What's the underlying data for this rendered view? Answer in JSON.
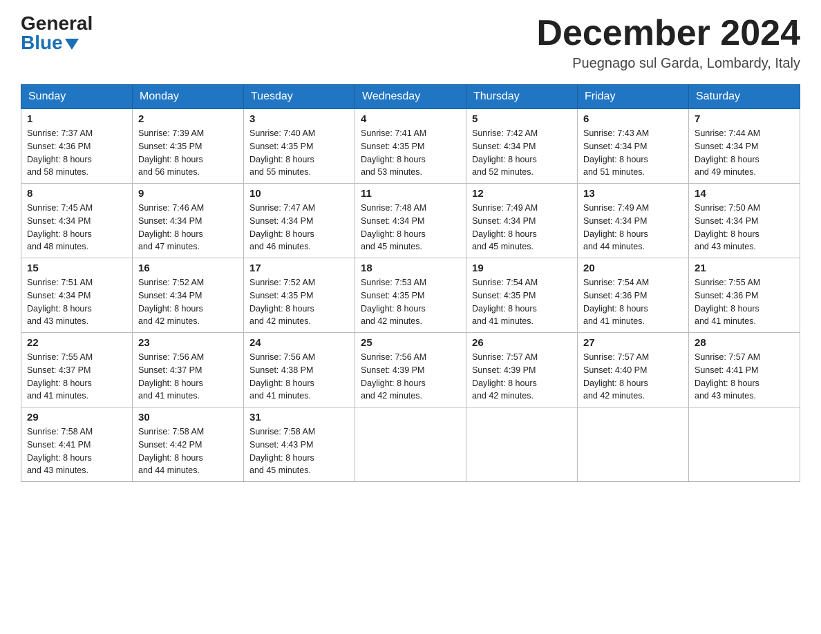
{
  "header": {
    "logo_general": "General",
    "logo_blue": "Blue",
    "month_title": "December 2024",
    "location": "Puegnago sul Garda, Lombardy, Italy"
  },
  "days_of_week": [
    "Sunday",
    "Monday",
    "Tuesday",
    "Wednesday",
    "Thursday",
    "Friday",
    "Saturday"
  ],
  "weeks": [
    [
      {
        "day": "1",
        "sunrise": "7:37 AM",
        "sunset": "4:36 PM",
        "daylight": "8 hours and 58 minutes."
      },
      {
        "day": "2",
        "sunrise": "7:39 AM",
        "sunset": "4:35 PM",
        "daylight": "8 hours and 56 minutes."
      },
      {
        "day": "3",
        "sunrise": "7:40 AM",
        "sunset": "4:35 PM",
        "daylight": "8 hours and 55 minutes."
      },
      {
        "day": "4",
        "sunrise": "7:41 AM",
        "sunset": "4:35 PM",
        "daylight": "8 hours and 53 minutes."
      },
      {
        "day": "5",
        "sunrise": "7:42 AM",
        "sunset": "4:34 PM",
        "daylight": "8 hours and 52 minutes."
      },
      {
        "day": "6",
        "sunrise": "7:43 AM",
        "sunset": "4:34 PM",
        "daylight": "8 hours and 51 minutes."
      },
      {
        "day": "7",
        "sunrise": "7:44 AM",
        "sunset": "4:34 PM",
        "daylight": "8 hours and 49 minutes."
      }
    ],
    [
      {
        "day": "8",
        "sunrise": "7:45 AM",
        "sunset": "4:34 PM",
        "daylight": "8 hours and 48 minutes."
      },
      {
        "day": "9",
        "sunrise": "7:46 AM",
        "sunset": "4:34 PM",
        "daylight": "8 hours and 47 minutes."
      },
      {
        "day": "10",
        "sunrise": "7:47 AM",
        "sunset": "4:34 PM",
        "daylight": "8 hours and 46 minutes."
      },
      {
        "day": "11",
        "sunrise": "7:48 AM",
        "sunset": "4:34 PM",
        "daylight": "8 hours and 45 minutes."
      },
      {
        "day": "12",
        "sunrise": "7:49 AM",
        "sunset": "4:34 PM",
        "daylight": "8 hours and 45 minutes."
      },
      {
        "day": "13",
        "sunrise": "7:49 AM",
        "sunset": "4:34 PM",
        "daylight": "8 hours and 44 minutes."
      },
      {
        "day": "14",
        "sunrise": "7:50 AM",
        "sunset": "4:34 PM",
        "daylight": "8 hours and 43 minutes."
      }
    ],
    [
      {
        "day": "15",
        "sunrise": "7:51 AM",
        "sunset": "4:34 PM",
        "daylight": "8 hours and 43 minutes."
      },
      {
        "day": "16",
        "sunrise": "7:52 AM",
        "sunset": "4:34 PM",
        "daylight": "8 hours and 42 minutes."
      },
      {
        "day": "17",
        "sunrise": "7:52 AM",
        "sunset": "4:35 PM",
        "daylight": "8 hours and 42 minutes."
      },
      {
        "day": "18",
        "sunrise": "7:53 AM",
        "sunset": "4:35 PM",
        "daylight": "8 hours and 42 minutes."
      },
      {
        "day": "19",
        "sunrise": "7:54 AM",
        "sunset": "4:35 PM",
        "daylight": "8 hours and 41 minutes."
      },
      {
        "day": "20",
        "sunrise": "7:54 AM",
        "sunset": "4:36 PM",
        "daylight": "8 hours and 41 minutes."
      },
      {
        "day": "21",
        "sunrise": "7:55 AM",
        "sunset": "4:36 PM",
        "daylight": "8 hours and 41 minutes."
      }
    ],
    [
      {
        "day": "22",
        "sunrise": "7:55 AM",
        "sunset": "4:37 PM",
        "daylight": "8 hours and 41 minutes."
      },
      {
        "day": "23",
        "sunrise": "7:56 AM",
        "sunset": "4:37 PM",
        "daylight": "8 hours and 41 minutes."
      },
      {
        "day": "24",
        "sunrise": "7:56 AM",
        "sunset": "4:38 PM",
        "daylight": "8 hours and 41 minutes."
      },
      {
        "day": "25",
        "sunrise": "7:56 AM",
        "sunset": "4:39 PM",
        "daylight": "8 hours and 42 minutes."
      },
      {
        "day": "26",
        "sunrise": "7:57 AM",
        "sunset": "4:39 PM",
        "daylight": "8 hours and 42 minutes."
      },
      {
        "day": "27",
        "sunrise": "7:57 AM",
        "sunset": "4:40 PM",
        "daylight": "8 hours and 42 minutes."
      },
      {
        "day": "28",
        "sunrise": "7:57 AM",
        "sunset": "4:41 PM",
        "daylight": "8 hours and 43 minutes."
      }
    ],
    [
      {
        "day": "29",
        "sunrise": "7:58 AM",
        "sunset": "4:41 PM",
        "daylight": "8 hours and 43 minutes."
      },
      {
        "day": "30",
        "sunrise": "7:58 AM",
        "sunset": "4:42 PM",
        "daylight": "8 hours and 44 minutes."
      },
      {
        "day": "31",
        "sunrise": "7:58 AM",
        "sunset": "4:43 PM",
        "daylight": "8 hours and 45 minutes."
      },
      null,
      null,
      null,
      null
    ]
  ],
  "labels": {
    "sunrise": "Sunrise:",
    "sunset": "Sunset:",
    "daylight": "Daylight:"
  }
}
